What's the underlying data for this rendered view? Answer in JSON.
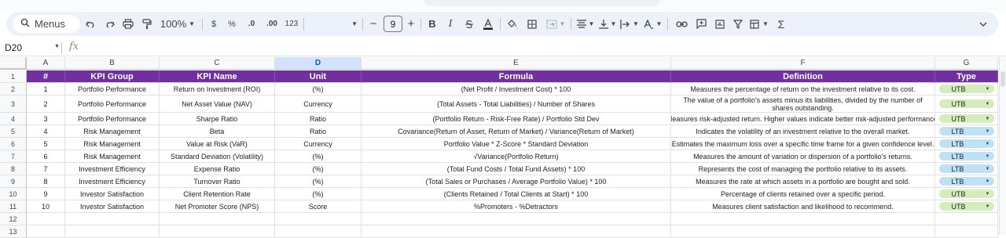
{
  "toolbar": {
    "search_label": "Menus",
    "zoom": "100%",
    "currency": "$",
    "percent": "%",
    "dec_decrease": ".0",
    "dec_increase": ".00",
    "number_format": "123",
    "font_size": "9",
    "minus": "−",
    "plus": "+",
    "bold": "B",
    "italic": "I",
    "sigma": "Σ"
  },
  "formula_bar": {
    "name_box": "D20",
    "fx": "fx",
    "content": ""
  },
  "columns": [
    "A",
    "B",
    "C",
    "D",
    "E",
    "F",
    "G"
  ],
  "selected_column": "D",
  "header_row": {
    "num": "#",
    "group": "KPI Group",
    "name": "KPI Name",
    "unit": "Unit",
    "formula": "Formula",
    "definition": "Definition",
    "type": "Type"
  },
  "row_numbers": [
    "1",
    "2",
    "3",
    "4",
    "5",
    "6",
    "7",
    "8",
    "9",
    "10",
    "11",
    "12",
    "13"
  ],
  "rows": [
    {
      "num": "1",
      "group": "Portfolio Performance",
      "name": "Return on Investment (ROI)",
      "unit": "(%)",
      "formula": "(Net Profit / Investment Cost) * 100",
      "definition": "Measures the percentage of return on the investment relative to its cost.",
      "type": "UTB"
    },
    {
      "num": "2",
      "group": "Portfolio Performance",
      "name": "Net Asset Value (NAV)",
      "unit": "Currency",
      "formula": "(Total Assets - Total Liabilities) / Number of Shares",
      "definition": "The value of a portfolio's assets minus its liabilities, divided by the number of shares outstanding.",
      "type": "UTB"
    },
    {
      "num": "3",
      "group": "Portfolio Performance",
      "name": "Sharpe Ratio",
      "unit": "Ratio",
      "formula": "(Portfolio Return - Risk-Free Rate) / Portfolio Std Dev",
      "definition": "Measures risk-adjusted return. Higher values indicate better risk-adjusted performance.",
      "type": "UTB"
    },
    {
      "num": "4",
      "group": "Risk Management",
      "name": "Beta",
      "unit": "Ratio",
      "formula": "Covariance(Return of Asset, Return of Market) / Variance(Return of Market)",
      "definition": "Indicates the volatility of an investment relative to the overall market.",
      "type": "LTB"
    },
    {
      "num": "5",
      "group": "Risk Management",
      "name": "Value at Risk (VaR)",
      "unit": "Currency",
      "formula": "Portfolio Value * Z-Score * Standard Deviation",
      "definition": "Estimates the maximum loss over a specific time frame for a given confidence level.",
      "type": "LTB"
    },
    {
      "num": "6",
      "group": "Risk Management",
      "name": "Standard Deviation (Volatility)",
      "unit": "(%)",
      "formula": "√Variance(Portfolio Return)",
      "definition": "Measures the amount of variation or dispersion of a portfolio's returns.",
      "type": "LTB"
    },
    {
      "num": "7",
      "group": "Investment Efficiency",
      "name": "Expense Ratio",
      "unit": "(%)",
      "formula": "(Total Fund Costs / Total Fund Assets) * 100",
      "definition": "Represents the cost of managing the portfolio relative to its assets.",
      "type": "LTB"
    },
    {
      "num": "8",
      "group": "Investment Efficiency",
      "name": "Turnover Ratio",
      "unit": "(%)",
      "formula": "(Total Sales or Purchases / Average Portfolio Value) * 100",
      "definition": "Measures the rate at which assets in a portfolio are bought and sold.",
      "type": "LTB"
    },
    {
      "num": "9",
      "group": "Investor Satisfaction",
      "name": "Client Retention Rate",
      "unit": "(%)",
      "formula": "(Clients Retained / Total Clients at Start) * 100",
      "definition": "Percentage of clients retained over a specific period.",
      "type": "UTB"
    },
    {
      "num": "10",
      "group": "Investor Satisfaction",
      "name": "Net Promoter Score (NPS)",
      "unit": "Score",
      "formula": "%Promoters - %Detractors",
      "definition": "Measures client satisfaction and likelihood to recommend.",
      "type": "UTB"
    }
  ],
  "colors": {
    "header_bg": "#7030a0",
    "utb_chip": "#d4edbc",
    "ltb_chip": "#bfe1f6",
    "selected_col": "#d3e3fd"
  }
}
